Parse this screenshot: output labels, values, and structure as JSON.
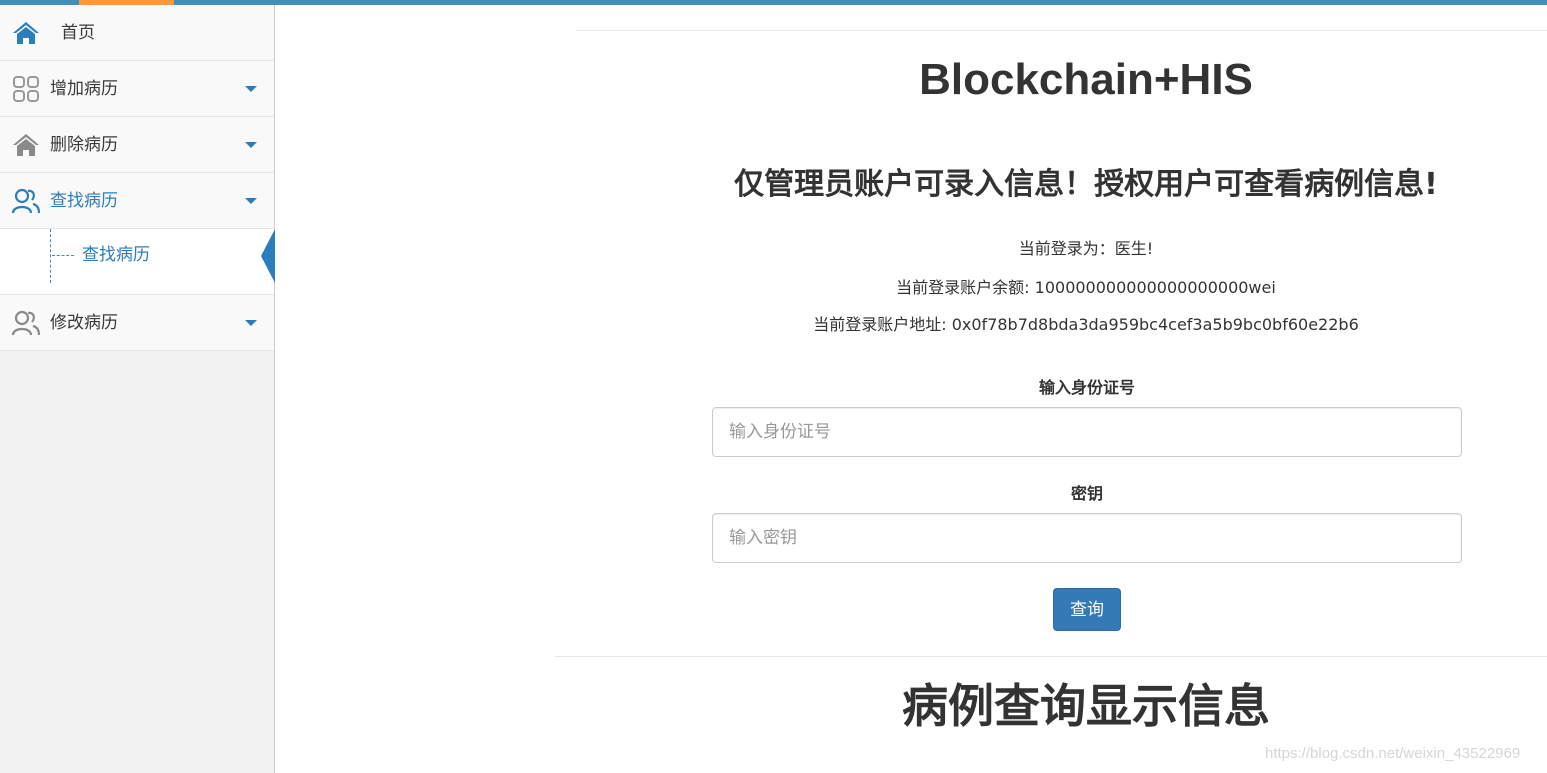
{
  "sidebar": {
    "home": {
      "label": "首页",
      "icon": "home-icon"
    },
    "items": [
      {
        "label": "增加病历",
        "icon": "grid-icon"
      },
      {
        "label": "删除病历",
        "icon": "home-outline-icon"
      },
      {
        "label": "查找病历",
        "icon": "users-icon",
        "active": true
      },
      {
        "label": "修改病历",
        "icon": "users-icon"
      }
    ],
    "submenu": [
      {
        "label": "查找病历"
      }
    ]
  },
  "main": {
    "title": "Blockchain+HIS",
    "subtitle": "仅管理员账户可录入信息！授权用户可查看病例信息!",
    "info": {
      "role": "当前登录为：医生!",
      "balance": "当前登录账户余额: 100000000000000000000wei",
      "address": "当前登录账户地址: 0x0f78b7d8bda3da959bc4cef3a5b9bc0bf60e22b6"
    },
    "form": {
      "id_label": "输入身份证号",
      "id_placeholder": "输入身份证号",
      "key_label": "密钥",
      "key_placeholder": "输入密钥",
      "submit_label": "查询"
    },
    "result_title": "病例查询显示信息"
  },
  "watermark": "https://blog.csdn.net/weixin_43522969",
  "colors": {
    "accent": "#438eb9",
    "accent_orange": "#f59942",
    "link": "#2b7dbc",
    "button": "#337ab7"
  }
}
